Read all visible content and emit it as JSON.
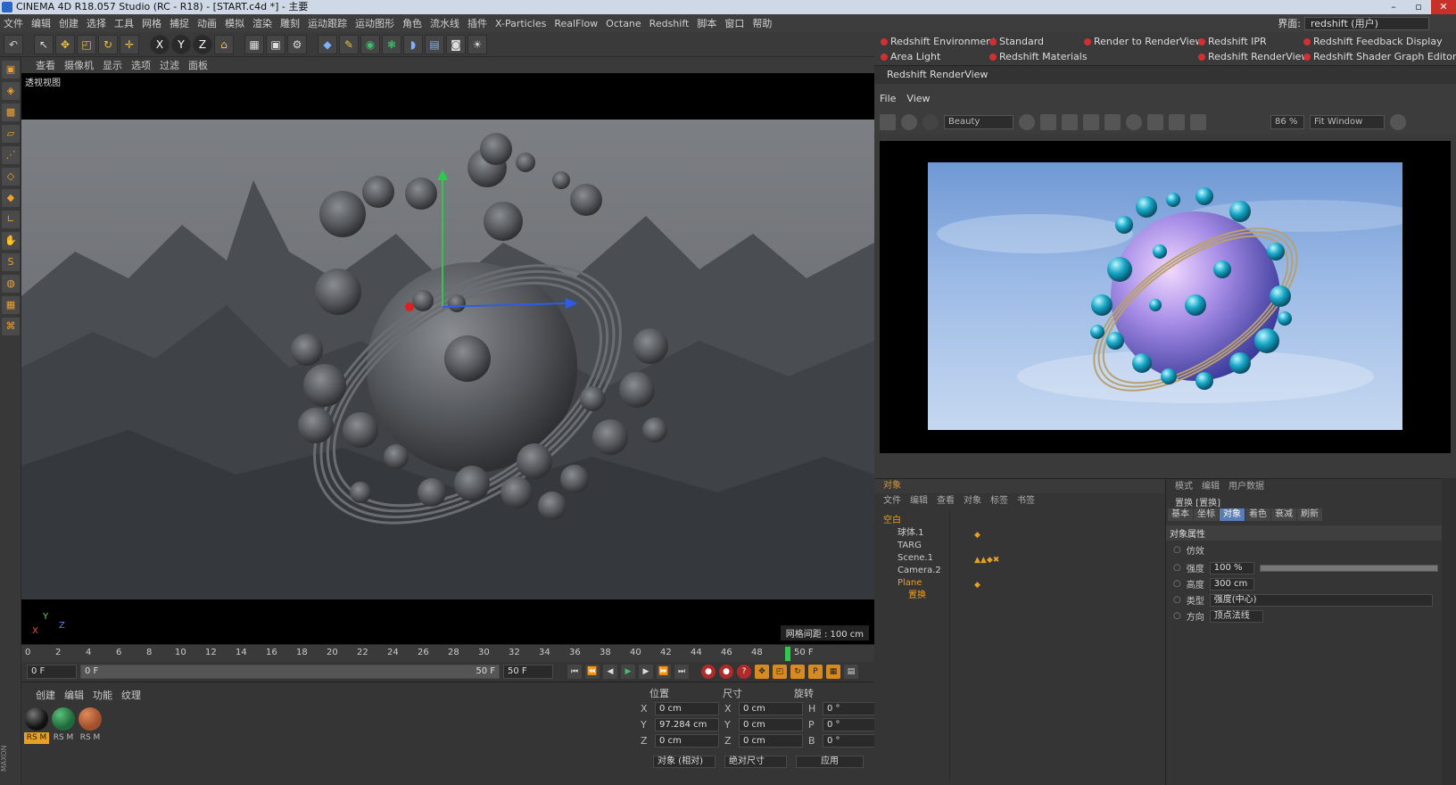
{
  "window": {
    "title": "CINEMA 4D R18.057 Studio (RC - R18) - [START.c4d *] - 主要"
  },
  "menu": [
    "文件",
    "编辑",
    "创建",
    "选择",
    "工具",
    "网格",
    "捕捉",
    "动画",
    "模拟",
    "渲染",
    "雕刻",
    "运动跟踪",
    "运动图形",
    "角色",
    "流水线",
    "插件",
    "X-Particles",
    "RealFlow",
    "Octane",
    "Redshift",
    "脚本",
    "窗口",
    "帮助"
  ],
  "layout": {
    "label": "界面:",
    "value": "redshift (用户)"
  },
  "viewport": {
    "menu": [
      "查看",
      "摄像机",
      "显示",
      "选项",
      "过滤",
      "面板"
    ],
    "label": "透视视图",
    "grid_label": "网格间距 : 100 cm",
    "axis_y": "Y",
    "axis_x": "X",
    "axis_z": "Z"
  },
  "timeline": {
    "ticks": [
      "0",
      "2",
      "4",
      "6",
      "8",
      "10",
      "12",
      "14",
      "16",
      "18",
      "20",
      "22",
      "24",
      "26",
      "28",
      "30",
      "32",
      "34",
      "36",
      "38",
      "40",
      "42",
      "44",
      "46",
      "48"
    ],
    "current_frame": "50 F",
    "start": "0 F",
    "range_start": "0 F",
    "range_end": "50 F",
    "end": "50 F"
  },
  "materials": {
    "menu": [
      "创建",
      "编辑",
      "功能",
      "纹理"
    ],
    "items": [
      {
        "label": "RS M",
        "color": "#111111"
      },
      {
        "label": "RS M",
        "color": "#1f6a3a"
      },
      {
        "label": "RS M",
        "color": "#a0502c"
      }
    ]
  },
  "coords": {
    "headers": [
      "位置",
      "尺寸",
      "旋转"
    ],
    "rows": [
      {
        "p_label": "X",
        "p_val": "0 cm",
        "s_label": "X",
        "s_val": "0 cm",
        "r_label": "H",
        "r_val": "0 °"
      },
      {
        "p_label": "Y",
        "p_val": "97.284 cm",
        "s_label": "Y",
        "s_val": "0 cm",
        "r_label": "P",
        "r_val": "0 °"
      },
      {
        "p_label": "Z",
        "p_val": "0 cm",
        "s_label": "Z",
        "s_val": "0 cm",
        "r_label": "B",
        "r_val": "0 °"
      }
    ],
    "mode1": "对象 (相对)",
    "mode2": "绝对尺寸",
    "apply": "应用"
  },
  "redshift_toolbar": [
    "Redshift Environment",
    "Standard",
    "Render to RenderView",
    "Redshift IPR",
    "Redshift Feedback Display",
    "Area Light",
    "Redshift Materials",
    "Redshift RenderView",
    "Redshift Shader Graph Editor"
  ],
  "renderview": {
    "title": "Redshift RenderView",
    "menu": [
      "File",
      "View"
    ],
    "aov": "Beauty",
    "zoom": "86 %",
    "fit": "Fit Window"
  },
  "objects": {
    "title": "对象",
    "menu": [
      "文件",
      "编辑",
      "查看",
      "对象",
      "标签",
      "书签"
    ],
    "items": [
      "空白",
      "球体.1",
      "TARG",
      "Scene.1",
      "Camera.2",
      "Plane",
      "置换"
    ]
  },
  "attributes": {
    "menu": [
      "模式",
      "编辑",
      "用户数据"
    ],
    "object": "置换 [置换]",
    "tabs": [
      "基本",
      "坐标",
      "对象",
      "着色",
      "衰减",
      "刷新"
    ],
    "active_tab": "对象",
    "section": "对象属性",
    "imitate": "仿效",
    "strength_label": "强度",
    "strength": "100 %",
    "height_label": "高度",
    "height": "300 cm",
    "type_label": "类型",
    "type": "强度(中心)",
    "dir_label": "方向",
    "dir": "顶点法线"
  },
  "colors": {
    "accent": "#e8a020",
    "rs_red": "#d23030",
    "active_tab": "#5a7fb8"
  }
}
